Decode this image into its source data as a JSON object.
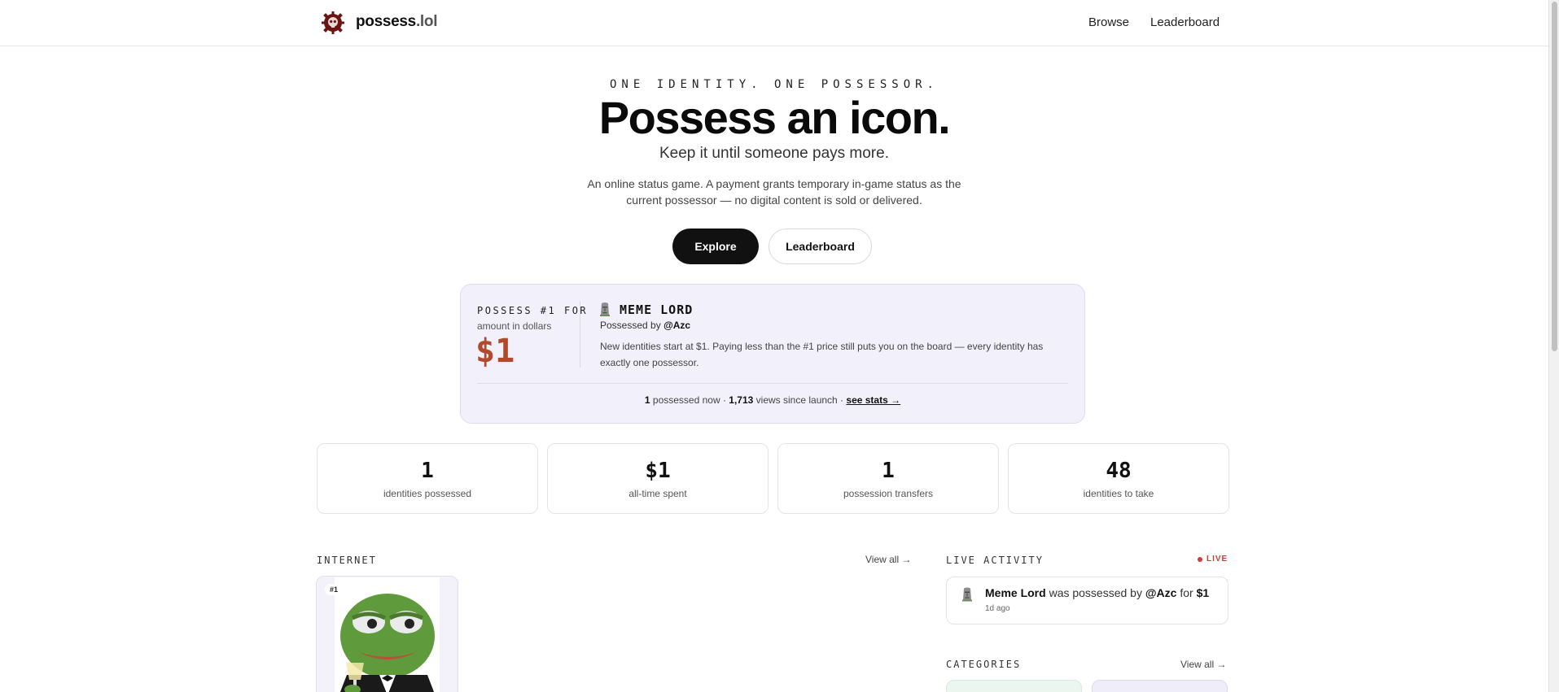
{
  "header": {
    "brand_name": "possess",
    "brand_tld": ".lol",
    "logo_icon": "skull-seal-icon",
    "nav": {
      "browse": "Browse",
      "leaderboard": "Leaderboard"
    }
  },
  "hero": {
    "eyebrow": "ONE IDENTITY. ONE POSSESSOR.",
    "title": "Possess an icon.",
    "subtitle": "Keep it until someone pays more.",
    "description": "An online status game. A payment grants temporary in-game status as the current possessor — no digital content is sold or delivered.",
    "primary_button": "Explore",
    "secondary_button": "Leaderboard"
  },
  "possess_card": {
    "eyebrow": "POSSESS #1 FOR",
    "amount_label": "amount in dollars",
    "price": "$1",
    "identity_icon": "moai-icon",
    "identity_name": "MEME LORD",
    "possessed_by_prefix": "Possessed by",
    "possessor": "@Azc",
    "info": "New identities start at $1. Paying less than the #1 price still puts you on the board — every identity has exactly one possessor.",
    "stats_possessed_count": "1",
    "stats_possessed_text": "possessed now ·",
    "stats_views_count": "1,713",
    "stats_views_text": "views since launch ·",
    "stats_link": "see stats →"
  },
  "stats": [
    {
      "value": "1",
      "label": "identities possessed"
    },
    {
      "value": "$1",
      "label": "all-time spent"
    },
    {
      "value": "1",
      "label": "possession transfers"
    },
    {
      "value": "48",
      "label": "identities to take"
    }
  ],
  "internet": {
    "title": "INTERNET",
    "view_all": "View all →",
    "card_rank": "#1",
    "card_image": "pepe-frog-tuxedo-image"
  },
  "live_activity": {
    "title": "LIVE ACTIVITY",
    "badge": "LIVE",
    "items": [
      {
        "icon": "moai-icon",
        "name": "Meme Lord",
        "verb": "was possessed by",
        "user": "@Azc",
        "for_text": "for",
        "amount": "$1",
        "time": "1d ago"
      }
    ]
  },
  "categories": {
    "title": "CATEGORIES",
    "view_all": "View all →"
  },
  "colors": {
    "accent_price": "#b04a2a",
    "card_bg": "#f1f0fb",
    "live": "#d23a3a",
    "primary_button": "#111111"
  }
}
